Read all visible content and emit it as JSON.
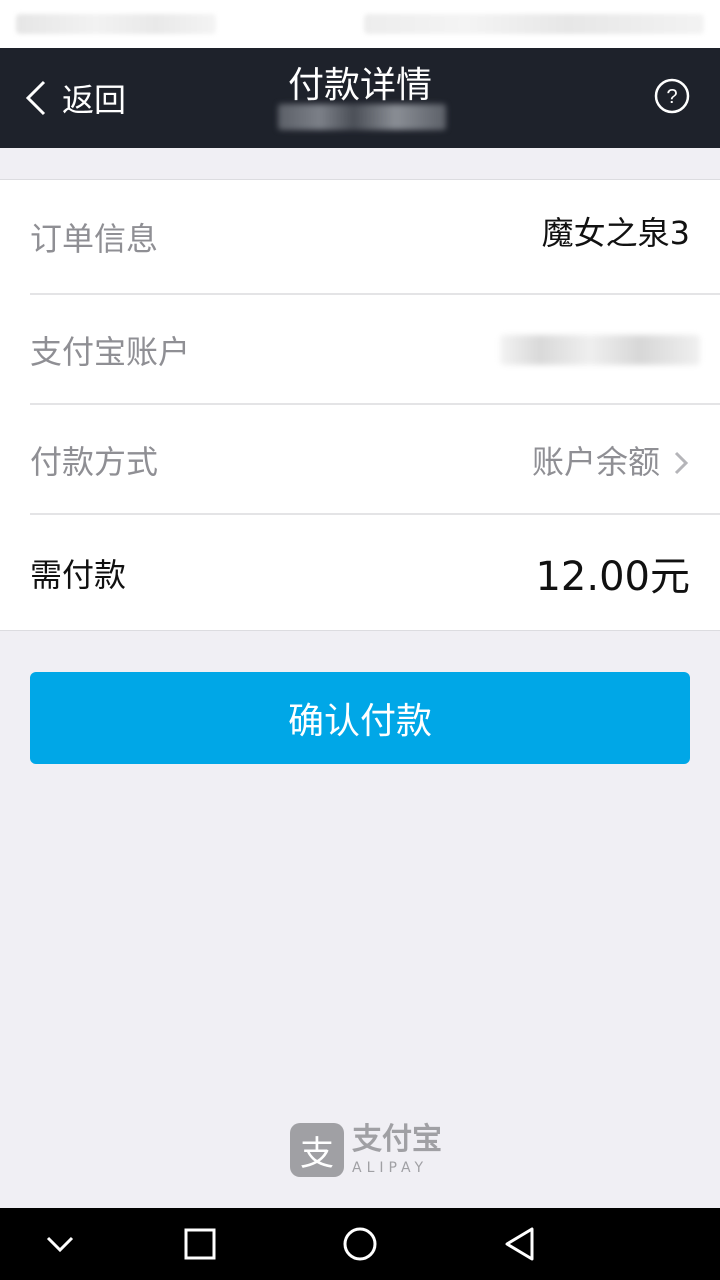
{
  "header": {
    "back_label": "返回",
    "title": "付款详情"
  },
  "details": {
    "order_label": "订单信息",
    "order_value": "魔女之泉3",
    "account_label": "支付宝账户",
    "method_label": "付款方式",
    "method_value": "账户余额",
    "amount_label": "需付款",
    "amount_value": "12.00元"
  },
  "actions": {
    "confirm_label": "确认付款"
  },
  "footer": {
    "brand_cn": "支付宝",
    "brand_en": "ALIPAY",
    "logo_glyph": "支"
  },
  "colors": {
    "titlebar": "#1e222b",
    "accent": "#00a7e7",
    "background": "#f0eff4"
  },
  "icons": [
    "back-chevron-icon",
    "help-icon",
    "chevron-right-icon",
    "nav-down-icon",
    "nav-square-icon",
    "nav-circle-icon",
    "nav-back-icon"
  ]
}
